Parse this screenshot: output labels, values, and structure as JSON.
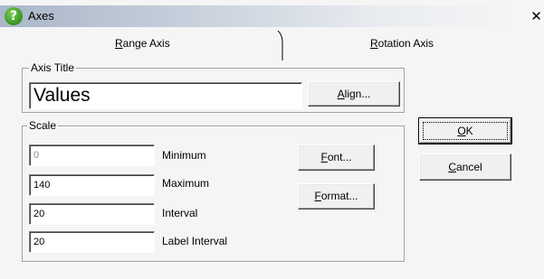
{
  "window": {
    "title": "Axes",
    "icon": "help-question-icon",
    "close_glyph": "✕"
  },
  "tabs": [
    {
      "accel": "R",
      "rest": "ange Axis",
      "selected": true
    },
    {
      "accel": "R",
      "rest": "otation Axis",
      "selected": false
    }
  ],
  "axis_title": {
    "legend": "Axis Title",
    "value": "Values",
    "align_button": {
      "accel": "A",
      "rest": "lign..."
    }
  },
  "scale": {
    "legend": "Scale",
    "minimum": {
      "label": "Minimum",
      "value": "0",
      "disabled": true
    },
    "maximum": {
      "label": "Maximum",
      "value": "140"
    },
    "interval": {
      "label": "Interval",
      "value": "20"
    },
    "label_interval": {
      "label": "Label Interval",
      "value": "20"
    },
    "font_button": {
      "accel": "F",
      "rest": "ont..."
    },
    "format_button": {
      "accel": "F",
      "rest": "ormat..."
    }
  },
  "buttons": {
    "ok": {
      "accel": "O",
      "rest": "K"
    },
    "cancel": {
      "accel": "C",
      "rest": "ancel"
    }
  },
  "colors": {
    "titlebar_start": "#a9b7c8",
    "titlebar_end": "#f7f7f7",
    "dialog_bg": "#f5f5f5",
    "disabled_text": "#8c8c8c"
  }
}
